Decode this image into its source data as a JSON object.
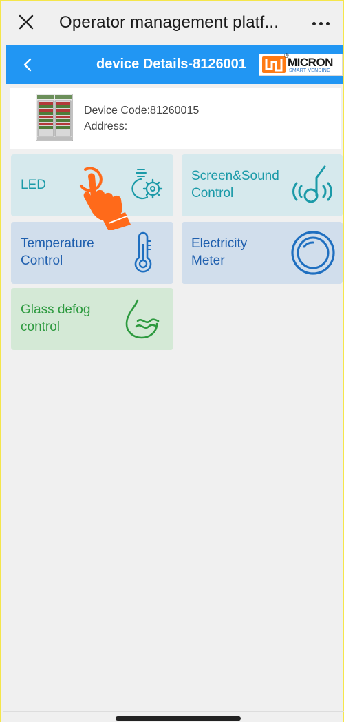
{
  "topbar": {
    "title": "Operator management platf...",
    "close_icon": "close-icon",
    "more_icon": "more-dots-icon"
  },
  "header": {
    "title": "device Details-8126001",
    "back_icon": "chevron-left-icon",
    "logo": {
      "brand": "MICRON",
      "tagline": "SMART VENDING"
    },
    "bg_color": "#2196f3"
  },
  "device": {
    "code_text": "Device Code:81260015",
    "address_text": "Address:"
  },
  "tiles": [
    {
      "label": "LED",
      "icon": "bulb-gear-icon",
      "color": "#1b9aa8"
    },
    {
      "label": "Screen&Sound\nControl",
      "icon": "sound-note-icon",
      "color": "#1b9aa8"
    },
    {
      "label": "Temperature\nControl",
      "icon": "thermometer-icon",
      "color": "#1f5fae"
    },
    {
      "label": "Electricity\nMeter",
      "icon": "meter-ring-icon",
      "color": "#1f5fae"
    },
    {
      "label": "Glass defog\ncontrol",
      "icon": "water-drop-wave-icon",
      "color": "#2d9a3f"
    }
  ]
}
